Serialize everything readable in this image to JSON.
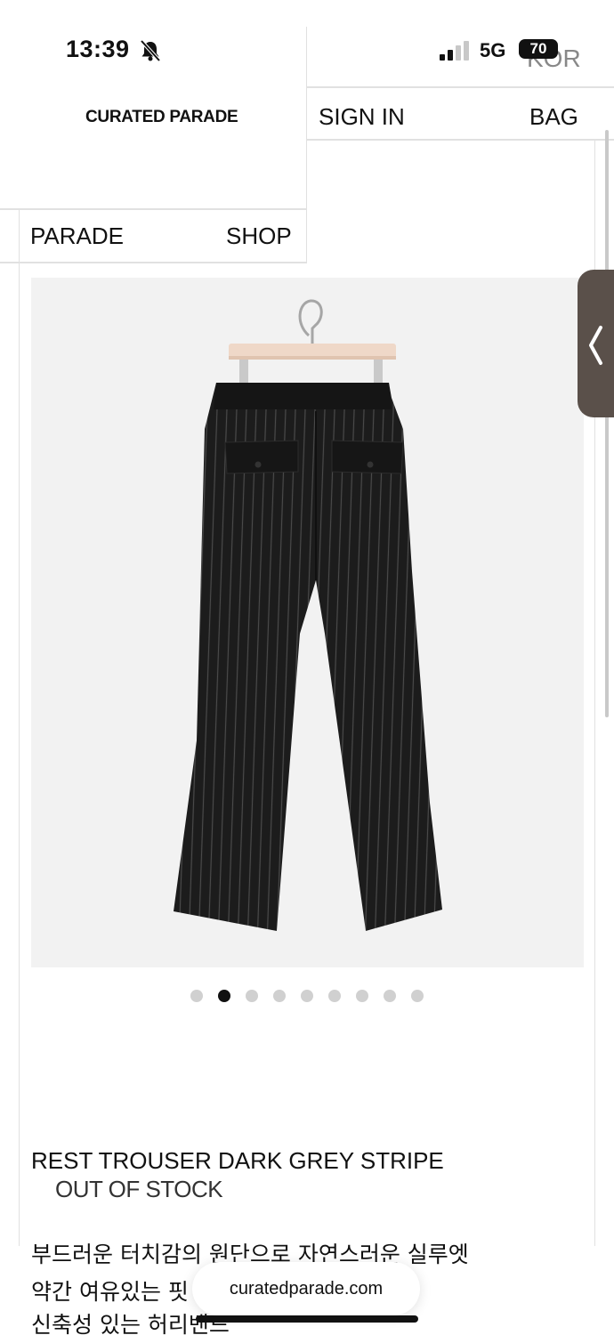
{
  "status_bar": {
    "time": "13:39",
    "network": "5G",
    "battery": "70"
  },
  "header": {
    "language": "KOR",
    "logo": "CURATED PARADE",
    "sign_in": "SIGN IN",
    "bag": "BAG",
    "menu_parade": "PARADE",
    "menu_shop": "SHOP"
  },
  "carousel": {
    "total": 9,
    "active_index": 1
  },
  "product": {
    "name": "REST TROUSER DARK GREY STRIPE",
    "stock_status": "OUT OF STOCK",
    "description_lines": [
      "부드러운 터치감의 원단으로 자연스러운 실루엣",
      "약간 여유있는 핏",
      "신축성 있는 허리밴드"
    ]
  },
  "browser": {
    "url": "curatedparade.com"
  }
}
